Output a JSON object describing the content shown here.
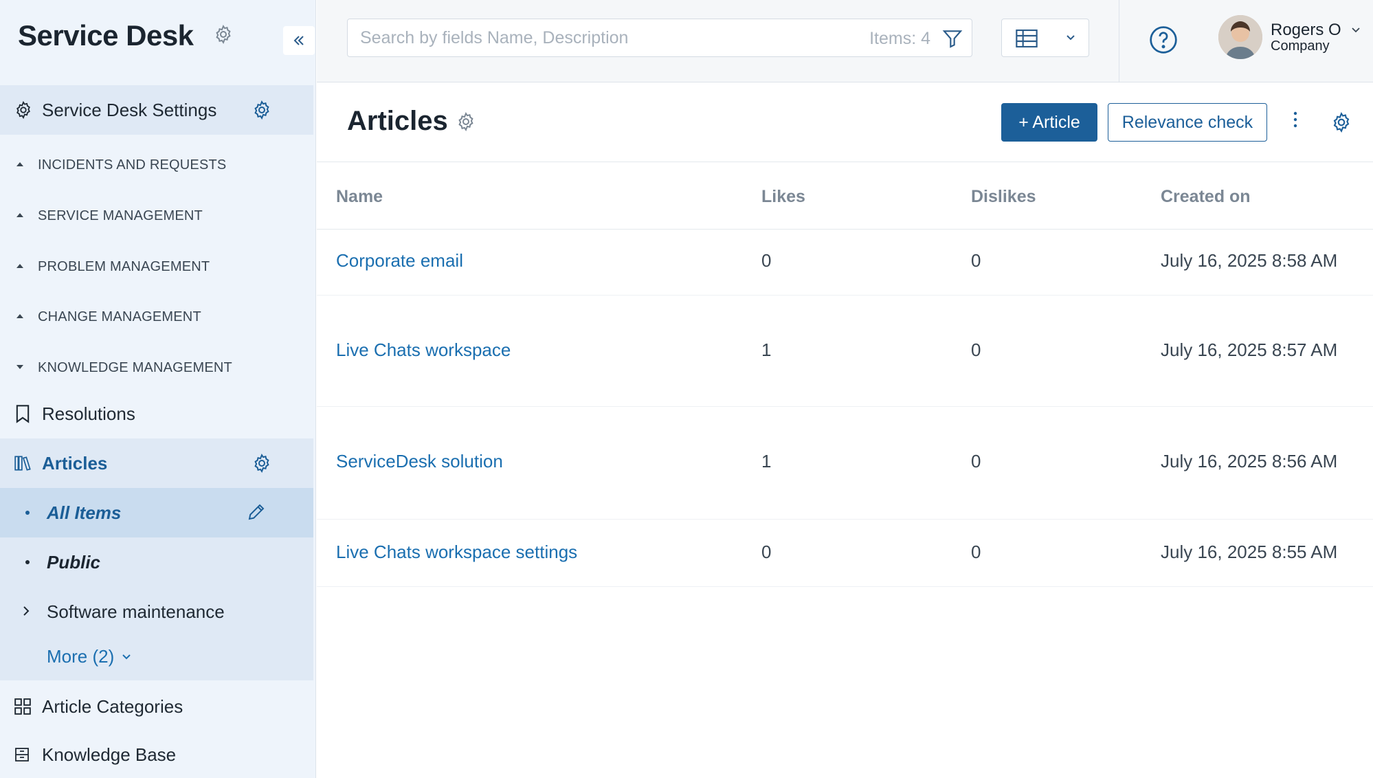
{
  "sidebar": {
    "brand_title": "Service Desk",
    "settings_label": "Service Desk Settings",
    "sections": [
      {
        "label": "INCIDENTS AND REQUESTS",
        "expanded": false
      },
      {
        "label": "SERVICE MANAGEMENT",
        "expanded": false
      },
      {
        "label": "PROBLEM MANAGEMENT",
        "expanded": false
      },
      {
        "label": "CHANGE MANAGEMENT",
        "expanded": false
      },
      {
        "label": "KNOWLEDGE MANAGEMENT",
        "expanded": true
      }
    ],
    "resolutions_label": "Resolutions",
    "articles_label": "Articles",
    "sub_items": {
      "all_items": "All Items",
      "public": "Public",
      "software": "Software maintenance",
      "more": "More (2)"
    },
    "article_categories_label": "Article Categories",
    "knowledge_base_label": "Knowledge Base"
  },
  "topbar": {
    "search_placeholder": "Search by fields Name, Description",
    "items_count": "Items: 4",
    "user_name": "Rogers O",
    "user_company": "Company"
  },
  "page": {
    "title": "Articles",
    "add_button": "+ Article",
    "relevance_button": "Relevance check"
  },
  "table": {
    "columns": [
      "Name",
      "Likes",
      "Dislikes",
      "Created on"
    ],
    "rows": [
      {
        "name": "Corporate email",
        "likes": "0",
        "dislikes": "0",
        "created": "July 16, 2025 8:58 AM"
      },
      {
        "name": "Live Chats workspace",
        "likes": "1",
        "dislikes": "0",
        "created": "July 16, 2025 8:57 AM"
      },
      {
        "name": "ServiceDesk solution",
        "likes": "1",
        "dislikes": "0",
        "created": "July 16, 2025 8:56 AM"
      },
      {
        "name": "Live Chats workspace settings",
        "likes": "0",
        "dislikes": "0",
        "created": "July 16, 2025 8:55 AM"
      }
    ]
  },
  "colors": {
    "accent": "#1c5f99",
    "link": "#1b6fb0",
    "sidebar_bg": "#eef4fb",
    "sidebar_active": "#c9dcef"
  },
  "icons": {
    "brand_settings": "gear-icon",
    "collapse": "double-chevron-left-icon",
    "resolutions": "bookmark-icon",
    "articles": "books-icon",
    "all_items_edit": "pencil-icon",
    "article_categories": "grid-icon",
    "knowledge_base": "archive-icon",
    "filter": "filter-icon",
    "view": "table-icon",
    "help": "question-circle-icon",
    "more": "kebab-icon"
  }
}
